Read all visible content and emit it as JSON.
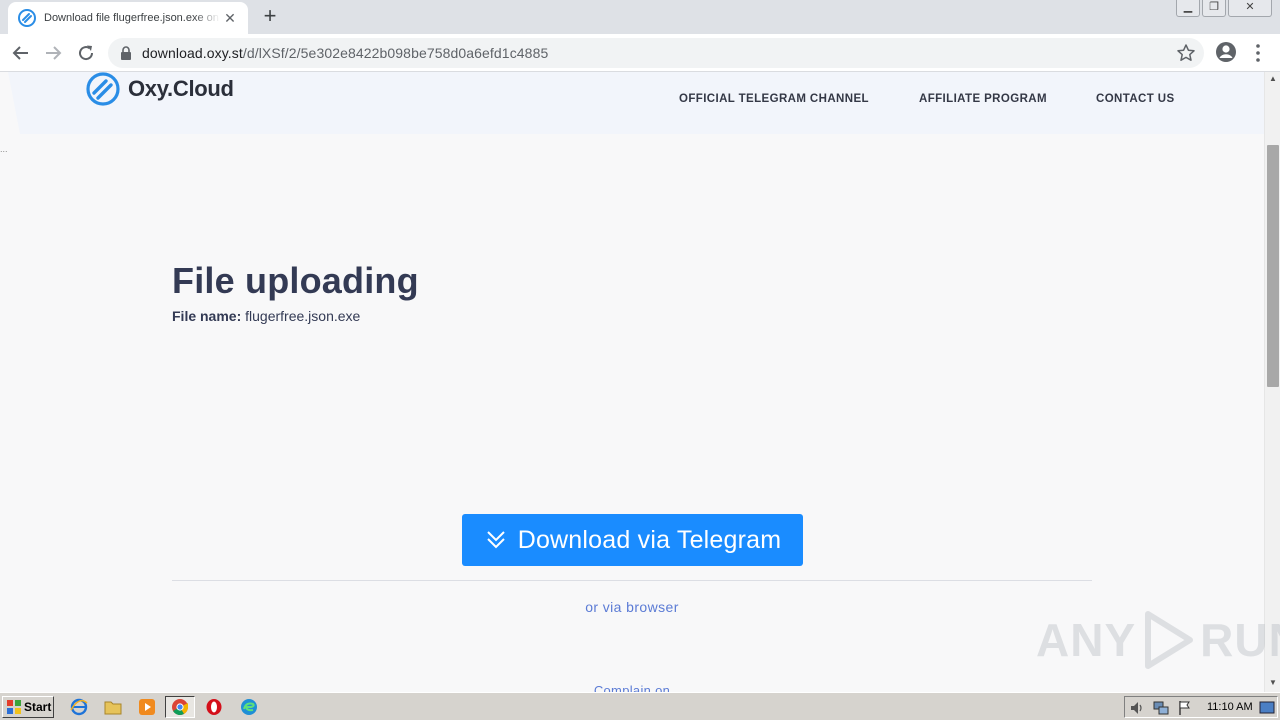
{
  "browser": {
    "tab_title": "Download file flugerfree.json.exe on",
    "url_host": "download.oxy.st",
    "url_path": "/d/lXSf/2/5e302e8422b098be758d0a6efd1c4885"
  },
  "site": {
    "logo_text": "Oxy.Cloud",
    "nav": {
      "telegram": "OFFICIAL TELEGRAM CHANNEL",
      "affiliate": "AFFILIATE PROGRAM",
      "contact": "CONTACT US"
    },
    "dots": "...",
    "title": "File uploading",
    "file_label": "File name:",
    "file_name": "flugerfree.json.exe",
    "download_button": "Download via Telegram",
    "browser_link": "or via browser",
    "complain_link": "Complain on"
  },
  "watermark": {
    "left": "ANY",
    "right": "RUN"
  },
  "taskbar": {
    "start_label": "Start",
    "clock": "11:10 AM"
  },
  "colors": {
    "accent": "#1a8cff",
    "title": "#333a54",
    "link": "#5b7bd5"
  }
}
